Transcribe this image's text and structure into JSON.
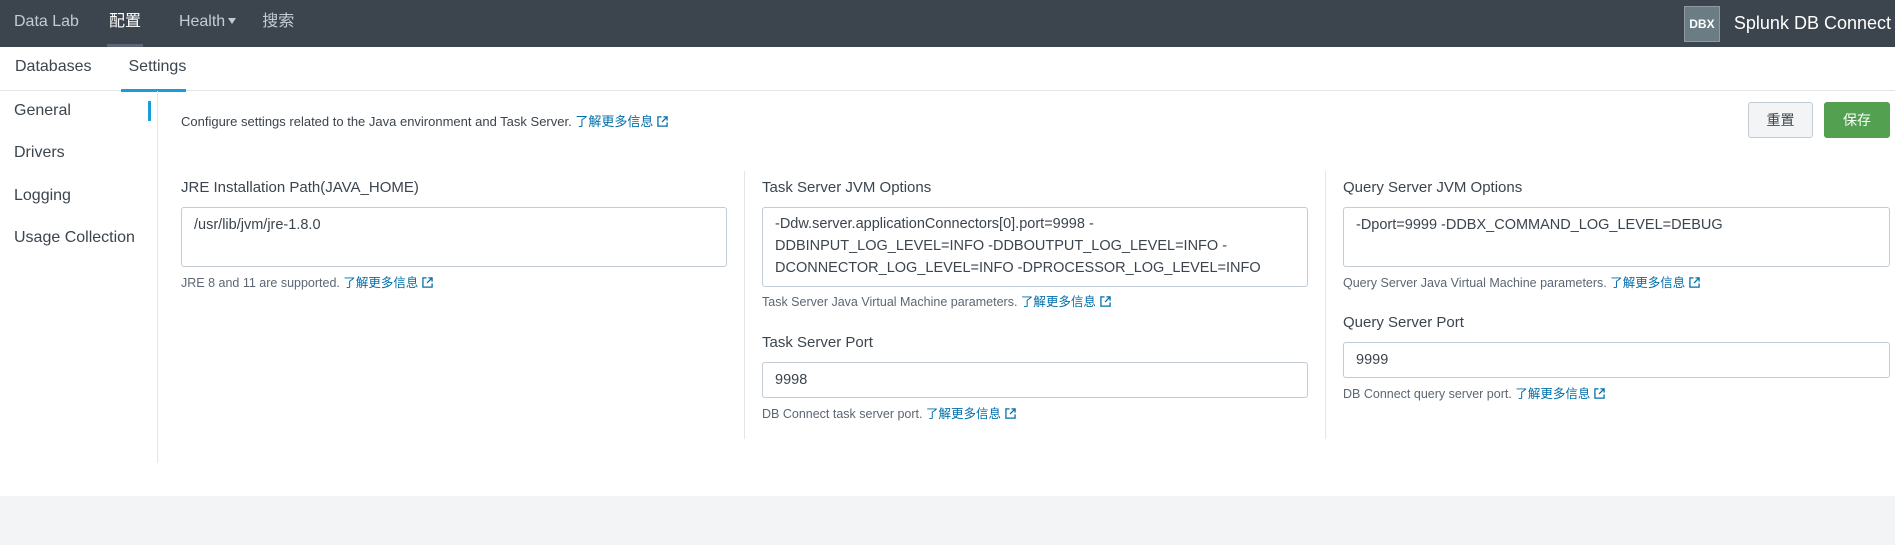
{
  "appbar": {
    "nav": [
      {
        "label": "Data Lab"
      },
      {
        "label": "配置"
      },
      {
        "label": "Health"
      },
      {
        "label": "搜索"
      }
    ],
    "badge": "DBX",
    "app_name": "Splunk DB Connect"
  },
  "tabs": [
    {
      "label": "Databases"
    },
    {
      "label": "Settings"
    }
  ],
  "sidenav": [
    {
      "label": "General"
    },
    {
      "label": "Drivers"
    },
    {
      "label": "Logging"
    },
    {
      "label": "Usage Collection"
    }
  ],
  "main": {
    "description": "Configure settings related to the Java environment and Task Server.",
    "learn_more": "了解更多信息",
    "reset_label": "重置",
    "save_label": "保存",
    "jre": {
      "label": "JRE Installation Path(JAVA_HOME)",
      "value": "/usr/lib/jvm/jre-1.8.0",
      "help": "JRE 8 and 11 are supported."
    },
    "task_jvm": {
      "label": "Task Server JVM Options",
      "value": "-Ddw.server.applicationConnectors[0].port=9998 -DDBINPUT_LOG_LEVEL=INFO -DDBOUTPUT_LOG_LEVEL=INFO -DCONNECTOR_LOG_LEVEL=INFO -DPROCESSOR_LOG_LEVEL=INFO",
      "help": "Task Server Java Virtual Machine parameters."
    },
    "task_port": {
      "label": "Task Server Port",
      "value": "9998",
      "help": "DB Connect task server port."
    },
    "query_jvm": {
      "label": "Query Server JVM Options",
      "value": "-Dport=9999 -DDBX_COMMAND_LOG_LEVEL=DEBUG",
      "help": "Query Server Java Virtual Machine parameters."
    },
    "query_port": {
      "label": "Query Server Port",
      "value": "9999",
      "help": "DB Connect query server port."
    }
  }
}
